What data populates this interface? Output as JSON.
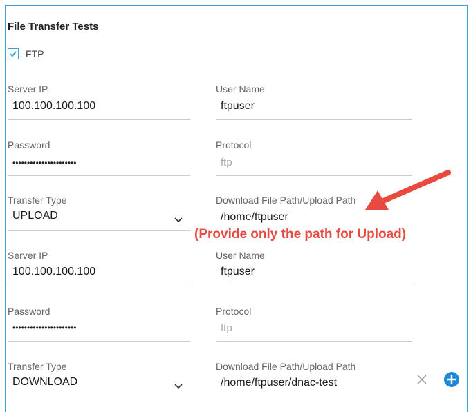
{
  "section": {
    "title": "File Transfer Tests",
    "ftp_label": "FTP",
    "ftp_checked": true
  },
  "blocks": [
    {
      "server_ip_label": "Server IP",
      "server_ip": "100.100.100.100",
      "user_name_label": "User Name",
      "user_name": "ftpuser",
      "password_label": "Password",
      "password": "••••••••••••••••••••••",
      "protocol_label": "Protocol",
      "protocol": "ftp",
      "transfer_type_label": "Transfer Type",
      "transfer_type": "UPLOAD",
      "path_label": "Download File Path/Upload Path",
      "path": "/home/ftpuser"
    },
    {
      "server_ip_label": "Server IP",
      "server_ip": "100.100.100.100",
      "user_name_label": "User Name",
      "user_name": "ftpuser",
      "password_label": "Password",
      "password": "••••••••••••••••••••••",
      "protocol_label": "Protocol",
      "protocol": "ftp",
      "transfer_type_label": "Transfer Type",
      "transfer_type": "DOWNLOAD",
      "path_label": "Download File Path/Upload Path",
      "path": "/home/ftpuser/dnac-test"
    }
  ],
  "annotation": {
    "text": "(Provide only the path for Upload)",
    "color": "#e84a3f"
  },
  "icons": {
    "checkbox": "check-icon",
    "dropdown": "chevron-down-icon",
    "clear": "close-icon",
    "add": "plus-circle-icon"
  },
  "colors": {
    "accent": "#3aa3d6",
    "add_button": "#1e88d9"
  }
}
